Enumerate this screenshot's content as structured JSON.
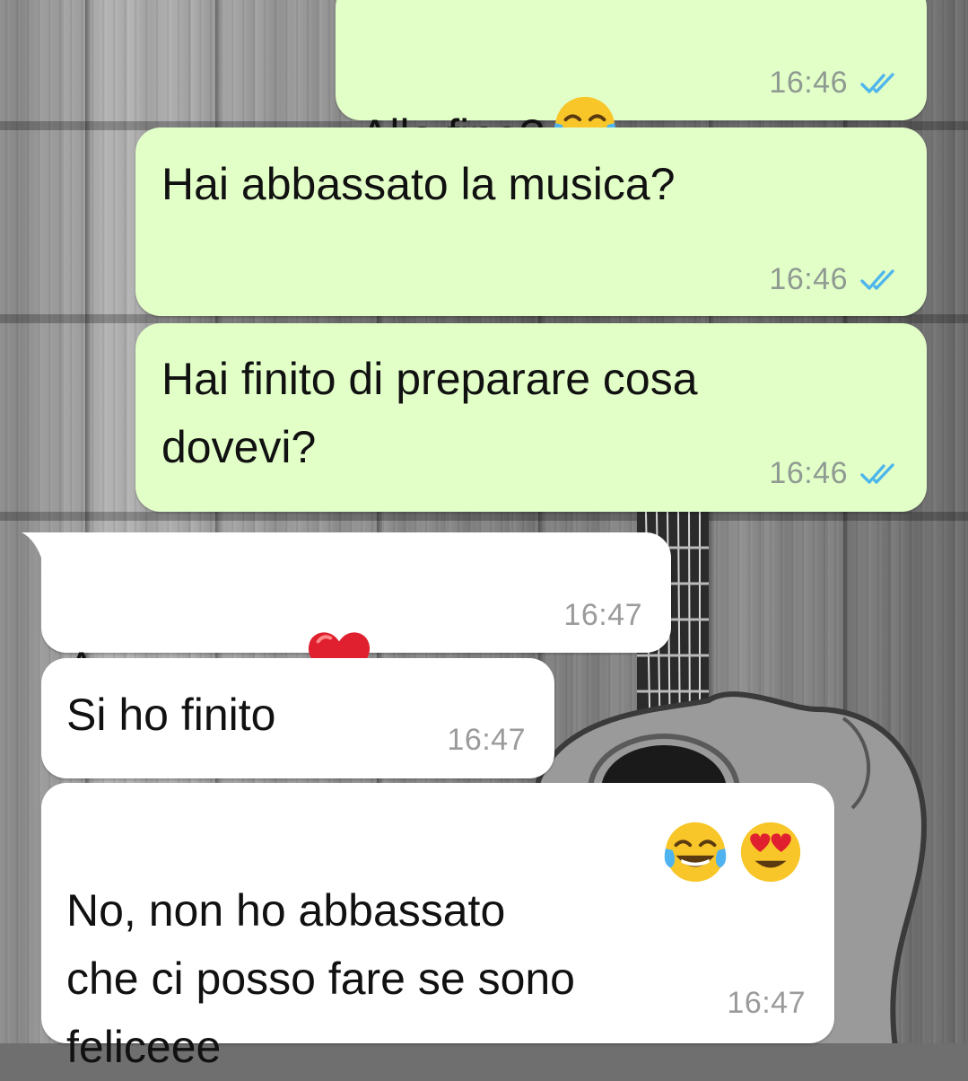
{
  "conversation": {
    "messages": [
      {
        "id": "m1",
        "direction": "outgoing",
        "text": "Alla fine?",
        "emojis": [
          "face-with-tears-of-joy"
        ],
        "time": "16:46",
        "status": "read"
      },
      {
        "id": "m2",
        "direction": "outgoing",
        "text": "Hai abbassato la musica?",
        "emojis": [],
        "time": "16:46",
        "status": "read"
      },
      {
        "id": "m3",
        "direction": "outgoing",
        "text": "Hai finito di preparare cosa\ndovevi?",
        "emojis": [],
        "time": "16:46",
        "status": "read"
      },
      {
        "id": "m4",
        "direction": "incoming",
        "text": "Amoooreee",
        "emojis": [
          "red-heart"
        ],
        "time": "16:47"
      },
      {
        "id": "m5",
        "direction": "incoming",
        "text": "Si ho finito",
        "emojis": [],
        "time": "16:47"
      },
      {
        "id": "m6",
        "direction": "incoming",
        "text": "No, non ho abbassato\nche ci posso fare se sono\nfeliceee",
        "emojis": [
          "face-with-tears-of-joy",
          "smiling-face-with-heart-eyes"
        ],
        "time": "16:47"
      }
    ]
  },
  "theme": {
    "outgoing_bubble": "#e2ffc8",
    "incoming_bubble": "#ffffff",
    "read_tick_color": "#4fb6ec",
    "time_color": "#8f9a92"
  }
}
